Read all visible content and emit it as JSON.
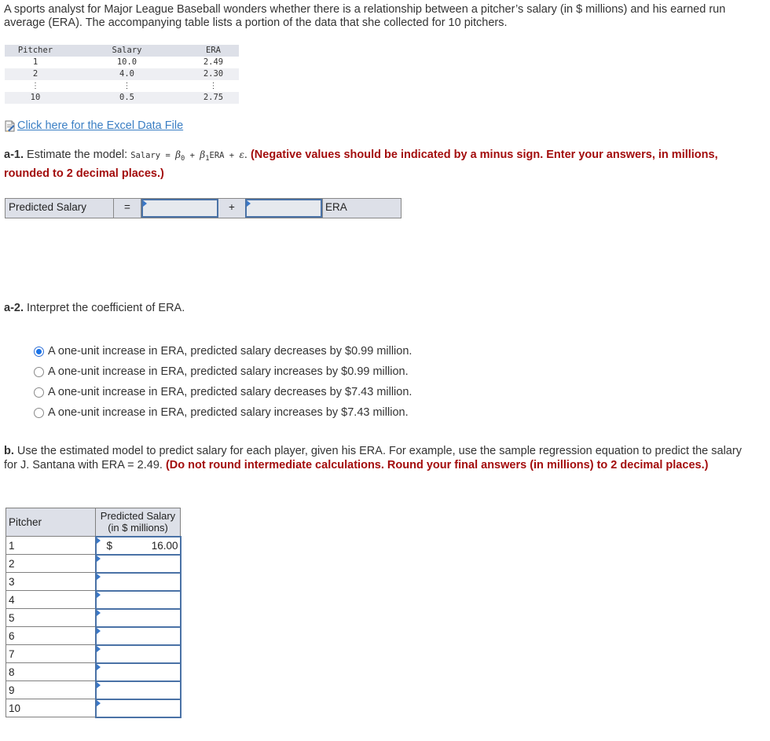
{
  "intro": "A sports analyst for Major League Baseball wonders whether there is a relationship between a pitcher’s salary (in $ millions) and his earned run average (ERA). The accompanying table lists a portion of the data that she collected for 10 pitchers.",
  "data_table": {
    "headers": [
      "Pitcher",
      "Salary",
      "ERA"
    ],
    "rows": [
      [
        "1",
        "10.0",
        "2.49"
      ],
      [
        "2",
        "4.0",
        "2.30"
      ],
      [
        "⋮",
        "⋮",
        "⋮"
      ],
      [
        "10",
        "0.5",
        "2.75"
      ]
    ]
  },
  "excel_link": {
    "icon": "spreadsheet-file-icon",
    "label": "Click here for the Excel Data File"
  },
  "a1": {
    "label": "a-1.",
    "text": " Estimate the model: ",
    "model_code_1": "Salary = ",
    "beta0": "β",
    "beta0_sub": "0",
    "model_code_2": " + ",
    "beta1": "β",
    "beta1_sub": "1",
    "model_code_3": "ERA + ",
    "epsilon": "ε",
    "after": ". ",
    "instruction": "(Negative values should be indicated by a minus sign. Enter your answers, in millions, rounded to 2 decimal places.)"
  },
  "equation": {
    "label": "Predicted Salary",
    "equals": "=",
    "intercept_value": "",
    "plus": "+",
    "slope_value": "",
    "variable": "ERA"
  },
  "a2": {
    "label": "a-2.",
    "text": " Interpret the coefficient of ERA.",
    "options": [
      {
        "label": "A one-unit increase in ERA, predicted salary decreases by $0.99 million.",
        "selected": true
      },
      {
        "label": "A one-unit increase in ERA, predicted salary increases by $0.99 million.",
        "selected": false
      },
      {
        "label": "A one-unit increase in ERA, predicted salary decreases by $7.43 million.",
        "selected": false
      },
      {
        "label": "A one-unit increase in ERA, predicted salary increases by $7.43 million.",
        "selected": false
      }
    ]
  },
  "b": {
    "label": "b.",
    "text": " Use the estimated model to predict salary for each player, given his ERA. For example, use the sample regression equation to predict the salary for J. Santana with ERA = 2.49. ",
    "instruction": "(Do not round intermediate calculations. Round your final answers (in millions) to 2 decimal places.)"
  },
  "predictions": {
    "header_pitcher": "Pitcher",
    "header_salary_1": "Predicted Salary",
    "header_salary_2": "(in $ millions)",
    "currency": "$",
    "rows": [
      {
        "pitcher": "1",
        "value": "16.00"
      },
      {
        "pitcher": "2",
        "value": ""
      },
      {
        "pitcher": "3",
        "value": ""
      },
      {
        "pitcher": "4",
        "value": ""
      },
      {
        "pitcher": "5",
        "value": ""
      },
      {
        "pitcher": "6",
        "value": ""
      },
      {
        "pitcher": "7",
        "value": ""
      },
      {
        "pitcher": "8",
        "value": ""
      },
      {
        "pitcher": "9",
        "value": ""
      },
      {
        "pitcher": "10",
        "value": ""
      }
    ]
  },
  "colors": {
    "instruction_red": "#a30d0d",
    "link_blue": "#3b7fc4",
    "input_border": "#4a72a6",
    "header_bg": "#dde0e8"
  }
}
